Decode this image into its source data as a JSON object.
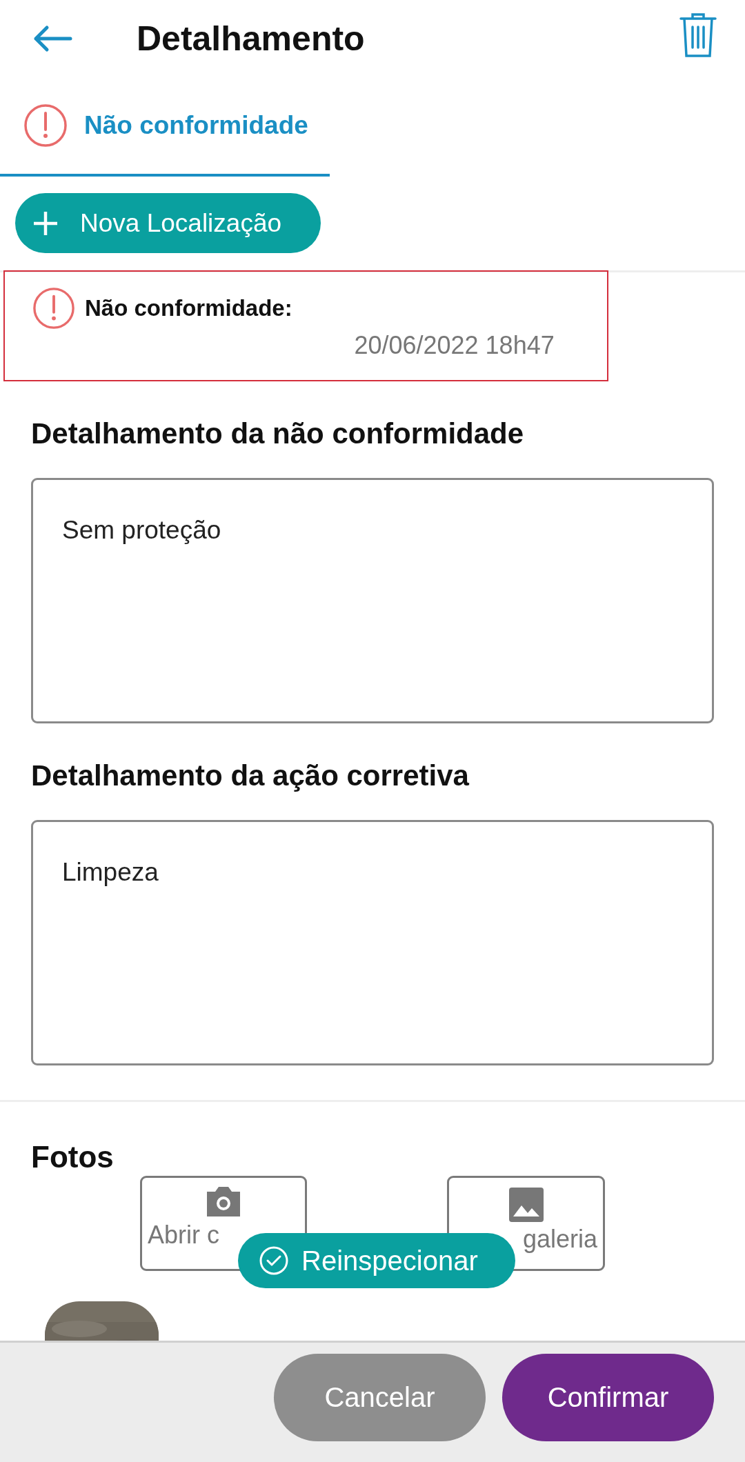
{
  "header": {
    "title": "Detalhamento"
  },
  "tabs": [
    {
      "label": "Não conformidade",
      "selected": true
    }
  ],
  "new_location": {
    "label": "Nova Localização"
  },
  "record": {
    "label": "Não conformidade:",
    "timestamp": "20/06/2022 18h47",
    "selected": true
  },
  "fields": [
    {
      "label": "Detalhamento da não conformidade",
      "value": "Sem proteção"
    },
    {
      "label": "Detalhamento da ação corretiva",
      "value": "Limpeza"
    }
  ],
  "photos": {
    "title": "Fotos",
    "buttons": [
      {
        "kind": "camera",
        "label": "Abrir c"
      },
      {
        "kind": "gallery",
        "label": "galeria"
      }
    ]
  },
  "floating_button": {
    "label": "Reinspecionar"
  },
  "footer": {
    "buttons": [
      {
        "kind": "secondary",
        "label": "Cancelar"
      },
      {
        "kind": "primary",
        "label": "Confirmar"
      }
    ]
  }
}
